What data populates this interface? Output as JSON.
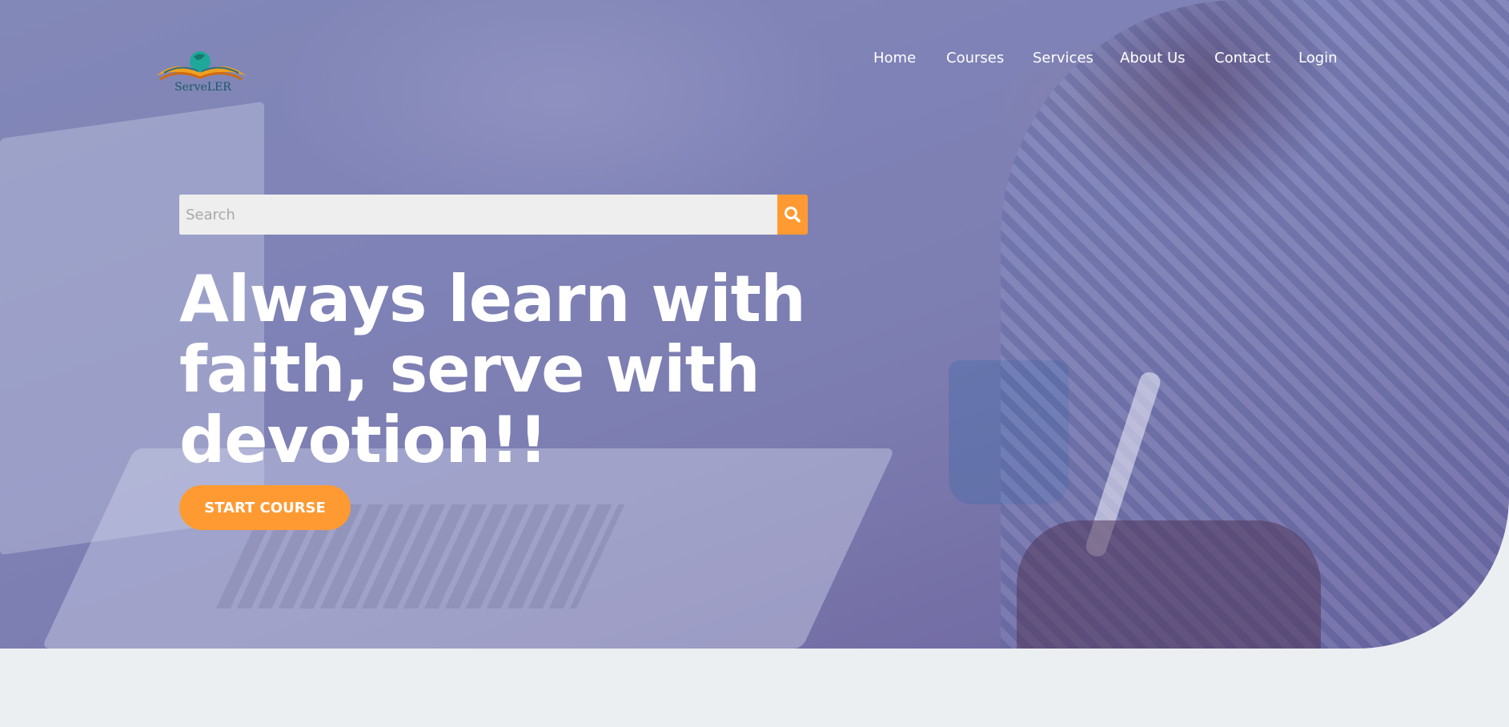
{
  "brand": {
    "logo_text": "ServeLER",
    "icon": "open-book-globe-logo"
  },
  "nav": {
    "items": [
      "Home",
      "Courses",
      "Services",
      "About Us",
      "Contact",
      "Login"
    ]
  },
  "search": {
    "placeholder": "Search",
    "value": "",
    "icon": "search-icon"
  },
  "hero": {
    "headline_lines": [
      "Always learn with",
      "faith, serve with",
      "devotion!!"
    ],
    "cta_label": "START COURSE"
  },
  "colors": {
    "accent": "#ff9a33",
    "hero_overlay": "#7f82b6",
    "page_background": "#eceff2",
    "text_on_hero": "#ffffff"
  }
}
